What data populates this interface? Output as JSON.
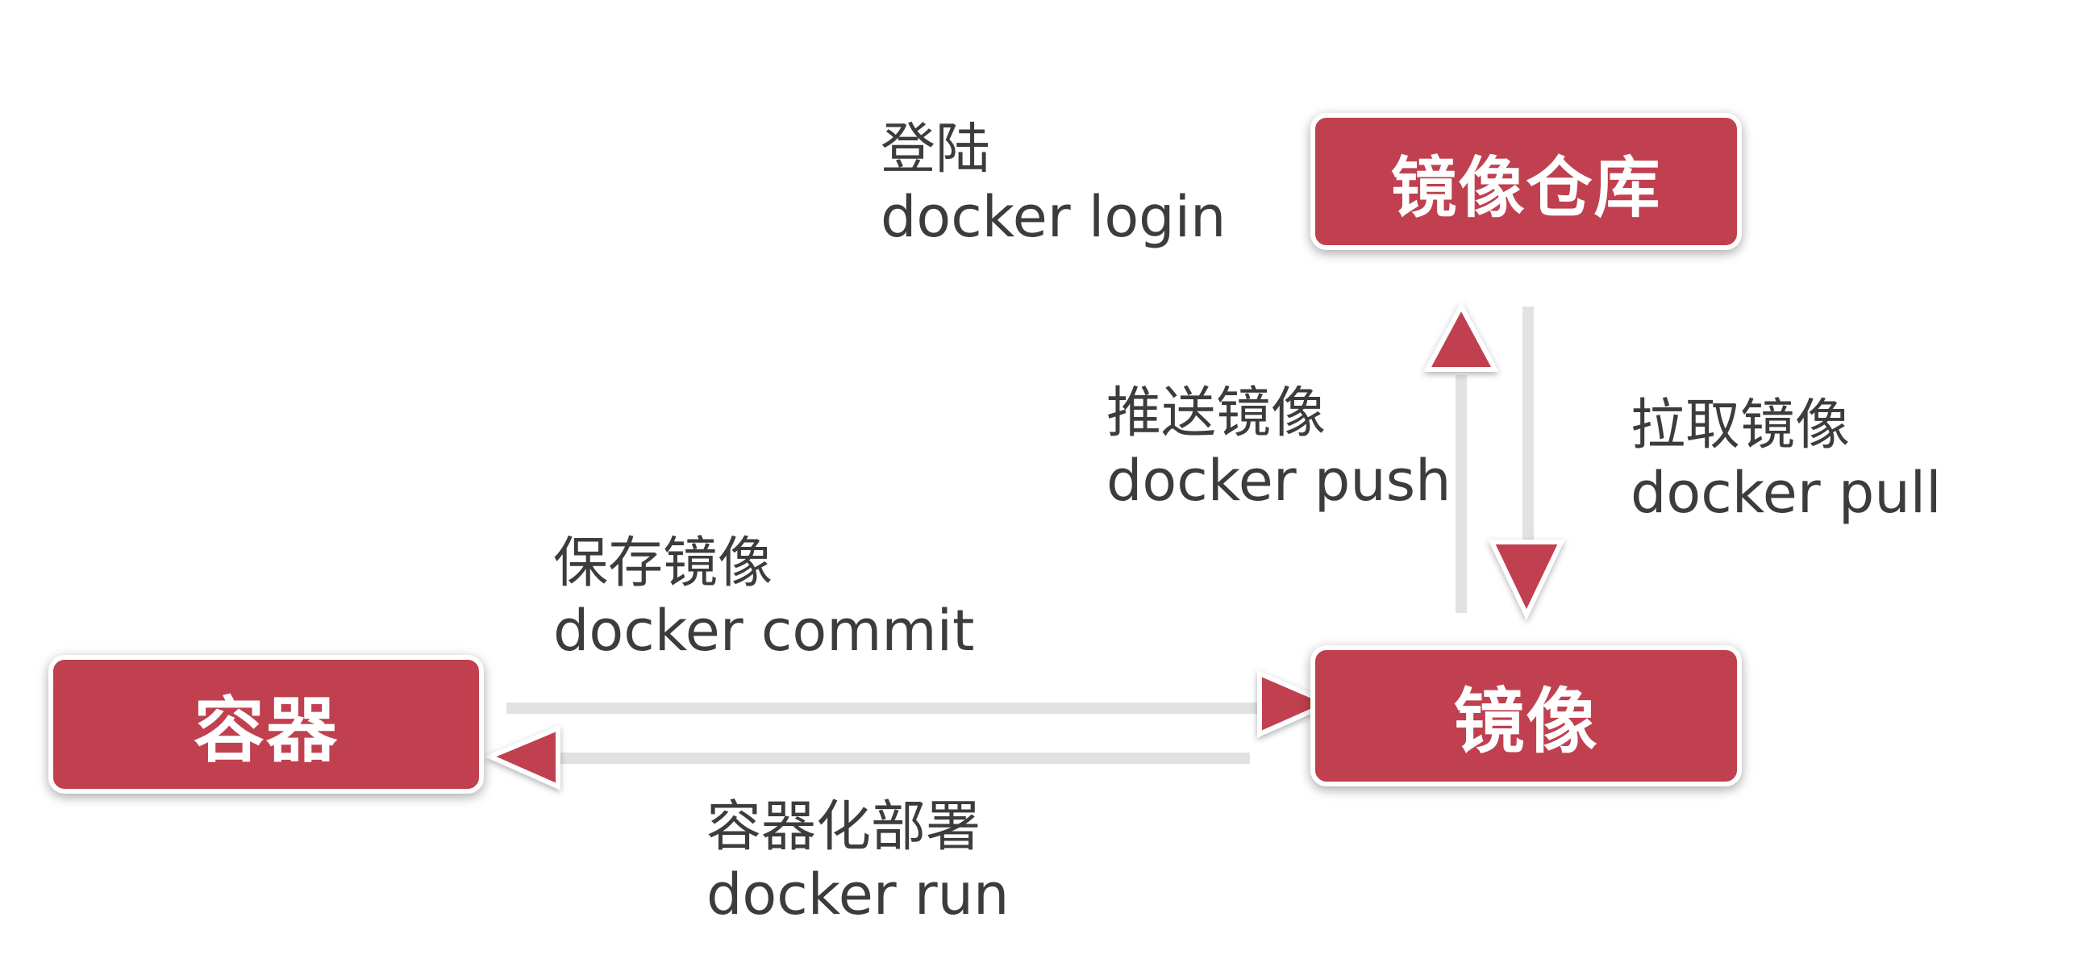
{
  "nodes": {
    "registry": "镜像仓库",
    "image": "镜像",
    "container": "容器"
  },
  "edges": {
    "login": {
      "cn": "登陆",
      "cmd": "docker login"
    },
    "push": {
      "cn": "推送镜像",
      "cmd": "docker push"
    },
    "pull": {
      "cn": "拉取镜像",
      "cmd": "docker pull"
    },
    "commit": {
      "cn": "保存镜像",
      "cmd": "docker commit"
    },
    "run": {
      "cn": "容器化部署",
      "cmd": "docker run"
    }
  },
  "colors": {
    "node_fill": "#c0404f",
    "arrow_fill": "#c0404f",
    "text": "#3c3c3c",
    "background": "#ffffff"
  }
}
